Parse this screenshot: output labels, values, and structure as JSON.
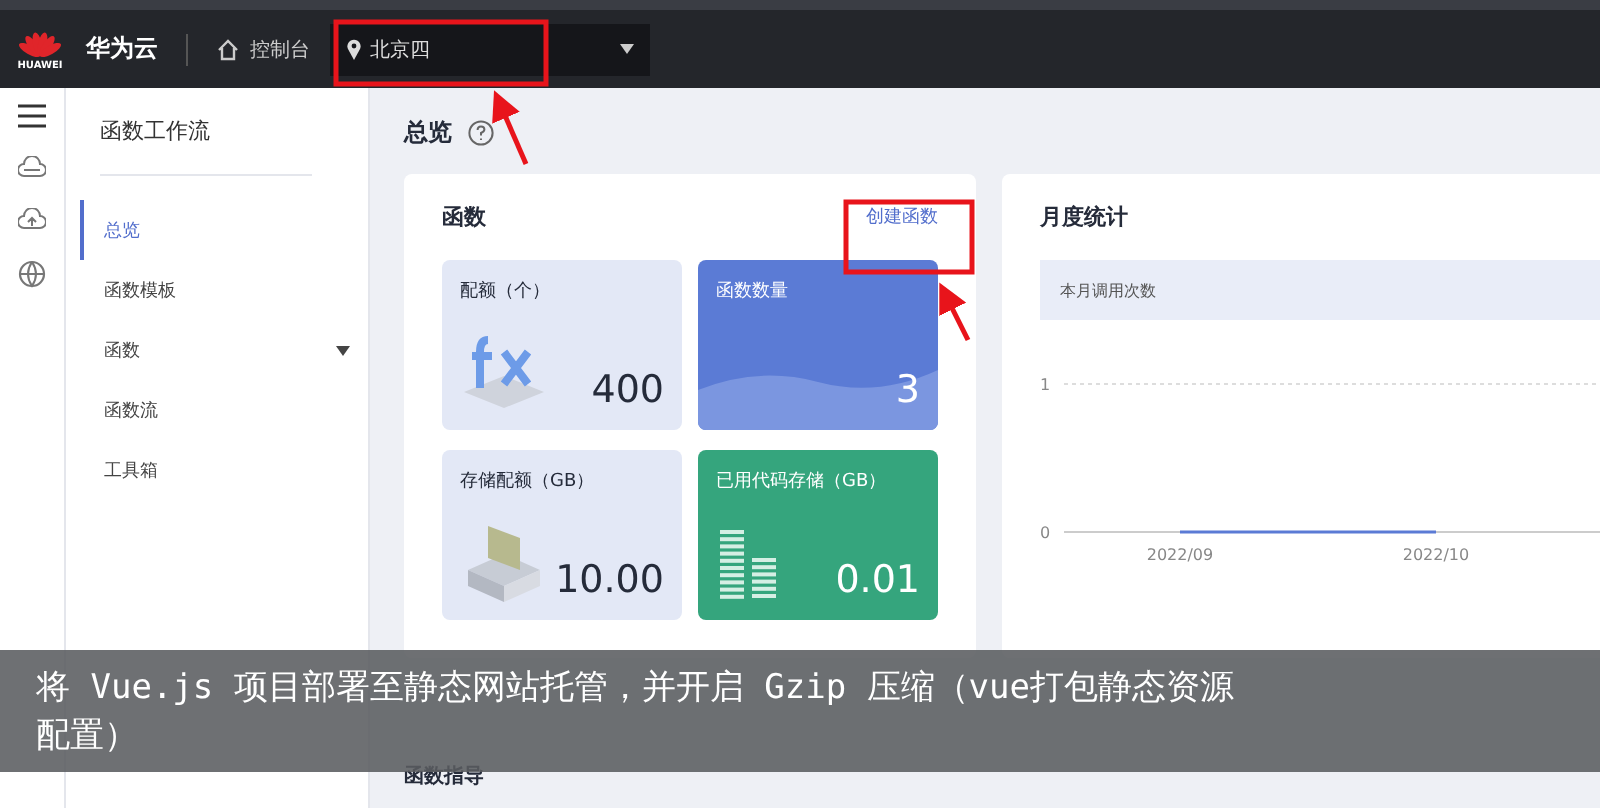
{
  "top_bar": {
    "logo_text": "HUAWEI",
    "brand": "华为云",
    "console": "控制台",
    "region": "北京四"
  },
  "sidebar": {
    "title": "函数工作流",
    "items": [
      {
        "label": "总览",
        "selected": true,
        "expandable": false
      },
      {
        "label": "函数模板",
        "selected": false,
        "expandable": false
      },
      {
        "label": "函数",
        "selected": false,
        "expandable": true
      },
      {
        "label": "函数流",
        "selected": false,
        "expandable": false
      },
      {
        "label": "工具箱",
        "selected": false,
        "expandable": false
      }
    ]
  },
  "page": {
    "title": "总览"
  },
  "functions_card": {
    "title": "函数",
    "link": "创建函数",
    "tiles": [
      {
        "kind": "quota",
        "label": "配额（个）",
        "value": "400"
      },
      {
        "kind": "count",
        "label": "函数数量",
        "value": "3"
      },
      {
        "kind": "storage",
        "label": "存储配额（GB）",
        "value": "10.00"
      },
      {
        "kind": "used",
        "label": "已用代码存储（GB）",
        "value": "0.01"
      }
    ]
  },
  "monthly_card": {
    "title": "月度统计",
    "chart_data": {
      "type": "line",
      "categories": [
        "2022/09",
        "2022/10"
      ],
      "yticks": [
        0,
        1
      ],
      "ylim": [
        0,
        1
      ],
      "series": [
        {
          "name": "本月调用次数",
          "color": "#5b7bd5",
          "values": [
            0,
            0
          ]
        }
      ]
    }
  },
  "guide_section": {
    "title": "函数指导"
  },
  "caption": "将 Vue.js 项目部署至静态网站托管，并开启 Gzip 压缩（vue打包静态资源配置）"
}
